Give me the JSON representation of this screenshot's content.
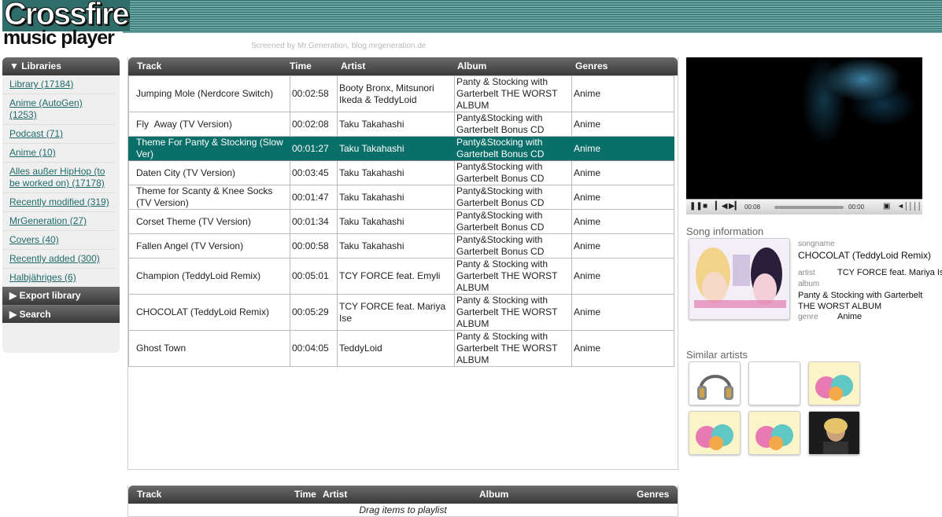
{
  "app": {
    "logo_line1": "Crossfire",
    "logo_line2": "music player",
    "credit": "Screened by Mr.Generation, blog.mrgeneration.de"
  },
  "sidebar": {
    "libraries_label": "▼ Libraries",
    "items": [
      {
        "label": "Library (17184)"
      },
      {
        "label": "Anime (AutoGen) (1253)"
      },
      {
        "label": "Podcast (71)"
      },
      {
        "label": "Anime (10)"
      },
      {
        "label": "Alles außer HipHop (to be worked on) (17178)"
      },
      {
        "label": "Recently modified (319)"
      },
      {
        "label": "MrGeneration (27)"
      },
      {
        "label": "Covers (40)"
      },
      {
        "label": "Recently added (300)"
      },
      {
        "label": "Halbjähriges (6)"
      }
    ],
    "export_label": "▶ Export library",
    "search_label": "▶ Search"
  },
  "track_table": {
    "columns": [
      "Track",
      "Time",
      "Artist",
      "Album",
      "Genres"
    ],
    "rows": [
      {
        "track": "Jumping Mole (Nerdcore Switch)",
        "time": "00:02:58",
        "artist": "Booty Bronx, Mitsunori Ikeda & TeddyLoid",
        "album": "Panty & Stocking with Garterbelt THE WORST ALBUM",
        "genre": "Anime"
      },
      {
        "track": "Fly  Away (TV Version)",
        "time": "00:02:08",
        "artist": "Taku Takahashi",
        "album": "Panty&Stocking with Garterbelt Bonus CD",
        "genre": "Anime"
      },
      {
        "track": "Theme For Panty & Stocking (Slow Ver)",
        "time": "00:01:27",
        "artist": "Taku Takahashi",
        "album": "Panty&Stocking with Garterbelt Bonus CD",
        "genre": "Anime"
      },
      {
        "track": "Daten City (TV Version)",
        "time": "00:03:45",
        "artist": "Taku Takahashi",
        "album": "Panty&Stocking with Garterbelt Bonus CD",
        "genre": "Anime"
      },
      {
        "track": "Theme for Scanty & Knee Socks (TV Version)",
        "time": "00:01:47",
        "artist": "Taku Takahashi",
        "album": "Panty&Stocking with Garterbelt Bonus CD",
        "genre": "Anime"
      },
      {
        "track": "Corset Theme (TV Version)",
        "time": "00:01:34",
        "artist": "Taku Takahashi",
        "album": "Panty&Stocking with Garterbelt Bonus CD",
        "genre": "Anime"
      },
      {
        "track": "Fallen Angel (TV Version)",
        "time": "00:00:58",
        "artist": "Taku Takahashi",
        "album": "Panty&Stocking with Garterbelt Bonus CD",
        "genre": "Anime"
      },
      {
        "track": "Champion (TeddyLoid Remix)",
        "time": "00:05:01",
        "artist": "TCY FORCE feat. Emyli",
        "album": "Panty & Stocking with Garterbelt THE WORST ALBUM",
        "genre": "Anime"
      },
      {
        "track": "CHOCOLAT (TeddyLoid Remix)",
        "time": "00:05:29",
        "artist": "TCY FORCE feat. Mariya Ise",
        "album": "Panty & Stocking with Garterbelt THE WORST ALBUM",
        "genre": "Anime"
      },
      {
        "track": "Ghost Town",
        "time": "00:04:05",
        "artist": "TeddyLoid",
        "album": "Panty & Stocking with Garterbelt THE WORST ALBUM",
        "genre": "Anime"
      }
    ],
    "selected_row": 2
  },
  "playlist_table": {
    "columns": [
      "Track",
      "Time",
      "Artist",
      "Album",
      "Genres"
    ],
    "drag_hint": "Drag items to playlist"
  },
  "player": {
    "time_current": "00:08",
    "time_total": "00:00",
    "progress": 0.0
  },
  "song_info": {
    "title": "Song information",
    "songname_label": "songname",
    "songname": "CHOCOLAT (TeddyLoid Remix)",
    "artist_label": "artist",
    "artist": "TCY FORCE feat. Mariya Ise",
    "album_label": "album",
    "album": "Panty & Stocking with Garterbelt THE WORST ALBUM",
    "genre_label": "genre",
    "genre": "Anime"
  },
  "similar_artists": {
    "title": "Similar artists",
    "thumbs": [
      "headphones-image",
      "blank-image",
      "album-art-image",
      "album-art-image",
      "album-art-image",
      "artist-photo-image"
    ]
  },
  "colors": {
    "accent": "#0a6e69",
    "header_dark": "#3a3a3a",
    "link": "#1f6b69"
  }
}
